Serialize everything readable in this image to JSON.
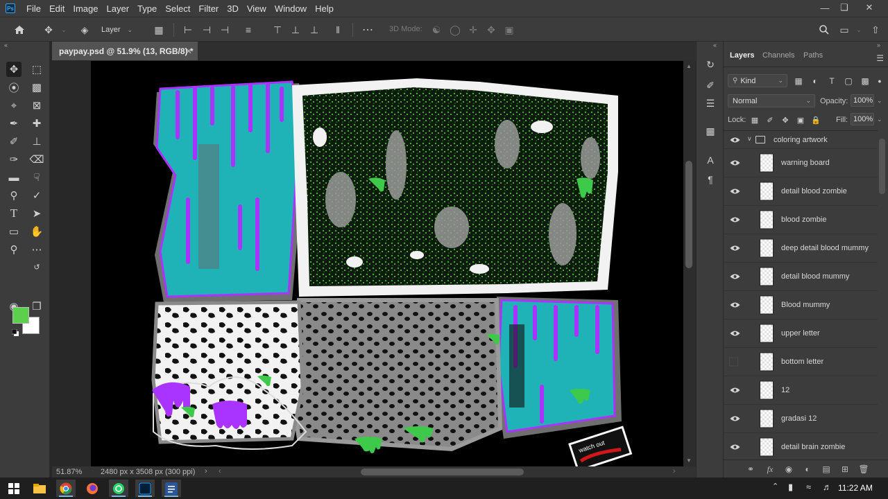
{
  "app": {
    "logo": "Ps",
    "menu": [
      "File",
      "Edit",
      "Image",
      "Layer",
      "Type",
      "Select",
      "Filter",
      "3D",
      "View",
      "Window",
      "Help"
    ]
  },
  "options_bar": {
    "auto_select_target": "Layer",
    "mode_3d_label": "3D Mode:"
  },
  "document": {
    "tab_title": "paypay.psd @ 51.9% (13, RGB/8) *",
    "zoom": "51.87%",
    "dimensions": "2480 px x 3508 px (300 ppi)"
  },
  "colors": {
    "foreground": "#5ccf4c",
    "background": "#ffffff",
    "cyan_fill": "#1fb3b8",
    "purple_drip": "#a933ff",
    "slime_green": "#3ec94a"
  },
  "panel": {
    "tabs": [
      "Layers",
      "Channels",
      "Paths"
    ],
    "active_tab": "Layers",
    "filter_kind": "Kind",
    "blend_mode": "Normal",
    "opacity_label": "Opacity:",
    "opacity": "100%",
    "lock_label": "Lock:",
    "fill_label": "Fill:",
    "fill": "100%",
    "layers": [
      {
        "name": "coloring artwork",
        "type": "group",
        "visible": true
      },
      {
        "name": "warning board",
        "type": "layer",
        "visible": true
      },
      {
        "name": "detail blood zombie",
        "type": "layer",
        "visible": true
      },
      {
        "name": "blood zombie",
        "type": "layer",
        "visible": true
      },
      {
        "name": "deep detail blood mummy",
        "type": "layer",
        "visible": true
      },
      {
        "name": "detail blood mummy",
        "type": "layer",
        "visible": true
      },
      {
        "name": "Blood mummy",
        "type": "layer",
        "visible": true
      },
      {
        "name": "upper letter",
        "type": "layer",
        "visible": true
      },
      {
        "name": "bottom letter",
        "type": "layer",
        "visible": false
      },
      {
        "name": "12",
        "type": "layer",
        "visible": true
      },
      {
        "name": "gradasi 12",
        "type": "layer",
        "visible": true
      },
      {
        "name": "detail brain zombie",
        "type": "layer",
        "visible": true
      }
    ]
  },
  "artwork": {
    "sign_text": "watch out"
  },
  "taskbar": {
    "time": "11:22 AM"
  }
}
